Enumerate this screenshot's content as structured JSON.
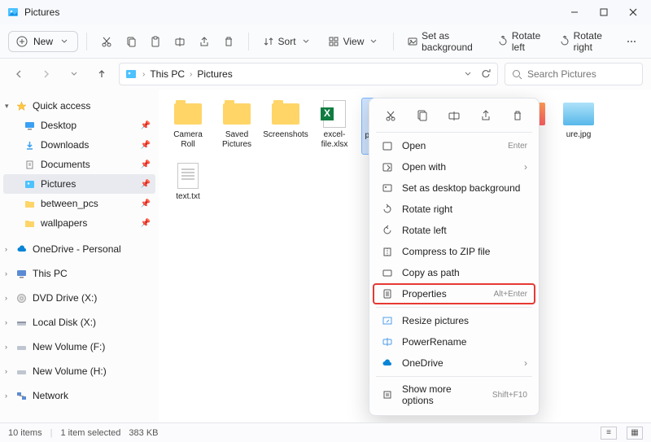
{
  "titlebar": {
    "title": "Pictures"
  },
  "toolbar": {
    "new_label": "New",
    "sort_label": "Sort",
    "view_label": "View",
    "set_bg_label": "Set as background",
    "rotate_left_label": "Rotate left",
    "rotate_right_label": "Rotate right"
  },
  "breadcrumb": {
    "root": "This PC",
    "folder": "Pictures"
  },
  "search": {
    "placeholder": "Search Pictures"
  },
  "sidebar": {
    "quick": "Quick access",
    "desktop": "Desktop",
    "downloads": "Downloads",
    "documents": "Documents",
    "pictures": "Pictures",
    "between_pcs": "between_pcs",
    "wallpapers": "wallpapers",
    "onedrive": "OneDrive - Personal",
    "thispc": "This PC",
    "dvd": "DVD Drive (X:)",
    "localdisk": "Local Disk (X:)",
    "newvol_f": "New Volume (F:)",
    "newvol_h": "New Volume (H:)",
    "network": "Network"
  },
  "files": {
    "camera_roll": "Camera Roll",
    "saved_pictures": "Saved Pictures",
    "screenshots": "Screenshots",
    "excel": "excel-file.xlsx",
    "selected": "picture (1)",
    "pic2": "",
    "pic3": "",
    "pic4": "",
    "pic5": "ure.jpg",
    "txt": "text.txt"
  },
  "ctx": {
    "open": "Open",
    "open_accel": "Enter",
    "open_with": "Open with",
    "set_bg": "Set as desktop background",
    "rotate_right": "Rotate right",
    "rotate_left": "Rotate left",
    "zip": "Compress to ZIP file",
    "copy_path": "Copy as path",
    "properties": "Properties",
    "properties_accel": "Alt+Enter",
    "resize": "Resize pictures",
    "powerrename": "PowerRename",
    "onedrive": "OneDrive",
    "more": "Show more options",
    "more_accel": "Shift+F10"
  },
  "status": {
    "count": "10 items",
    "selection": "1 item selected",
    "size": "383 KB"
  }
}
